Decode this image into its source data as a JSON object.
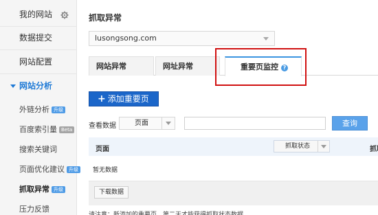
{
  "sidebar": {
    "items": [
      {
        "label": "我的网站"
      },
      {
        "label": "数据提交"
      },
      {
        "label": "网站配置"
      },
      {
        "label": "网站分析"
      }
    ],
    "sub_items": [
      {
        "label": "外链分析",
        "badge": "升级"
      },
      {
        "label": "百度索引量",
        "badge": "Beta"
      },
      {
        "label": "搜索关键词",
        "badge": ""
      },
      {
        "label": "页面优化建议",
        "badge": "升级"
      },
      {
        "label": "抓取异常",
        "badge": "升级"
      },
      {
        "label": "压力反馈",
        "badge": ""
      }
    ]
  },
  "main": {
    "title": "抓取异常",
    "site_select": "lusongsong.com",
    "tabs": [
      {
        "label": "网站异常"
      },
      {
        "label": "网址异常"
      },
      {
        "label": "重要页监控"
      }
    ],
    "help_icon_text": "?",
    "add_button": {
      "icon": "+",
      "label": "添加重要页"
    },
    "filter": {
      "label": "查看数据",
      "select_value": "页面",
      "input_value": "",
      "query_button": "查询"
    },
    "table": {
      "col_page": "页面",
      "col_status": "抓取状态",
      "col_extra": "抓取",
      "empty_text": "暂无数据"
    },
    "download_button": "下载数据",
    "footer_note": "请注意：新添加的重要页，第二天才能获得抓取状态数据"
  },
  "colors": {
    "accent": "#1f7ad6",
    "button_primary": "#1b66c9",
    "highlight": "#d01010"
  }
}
